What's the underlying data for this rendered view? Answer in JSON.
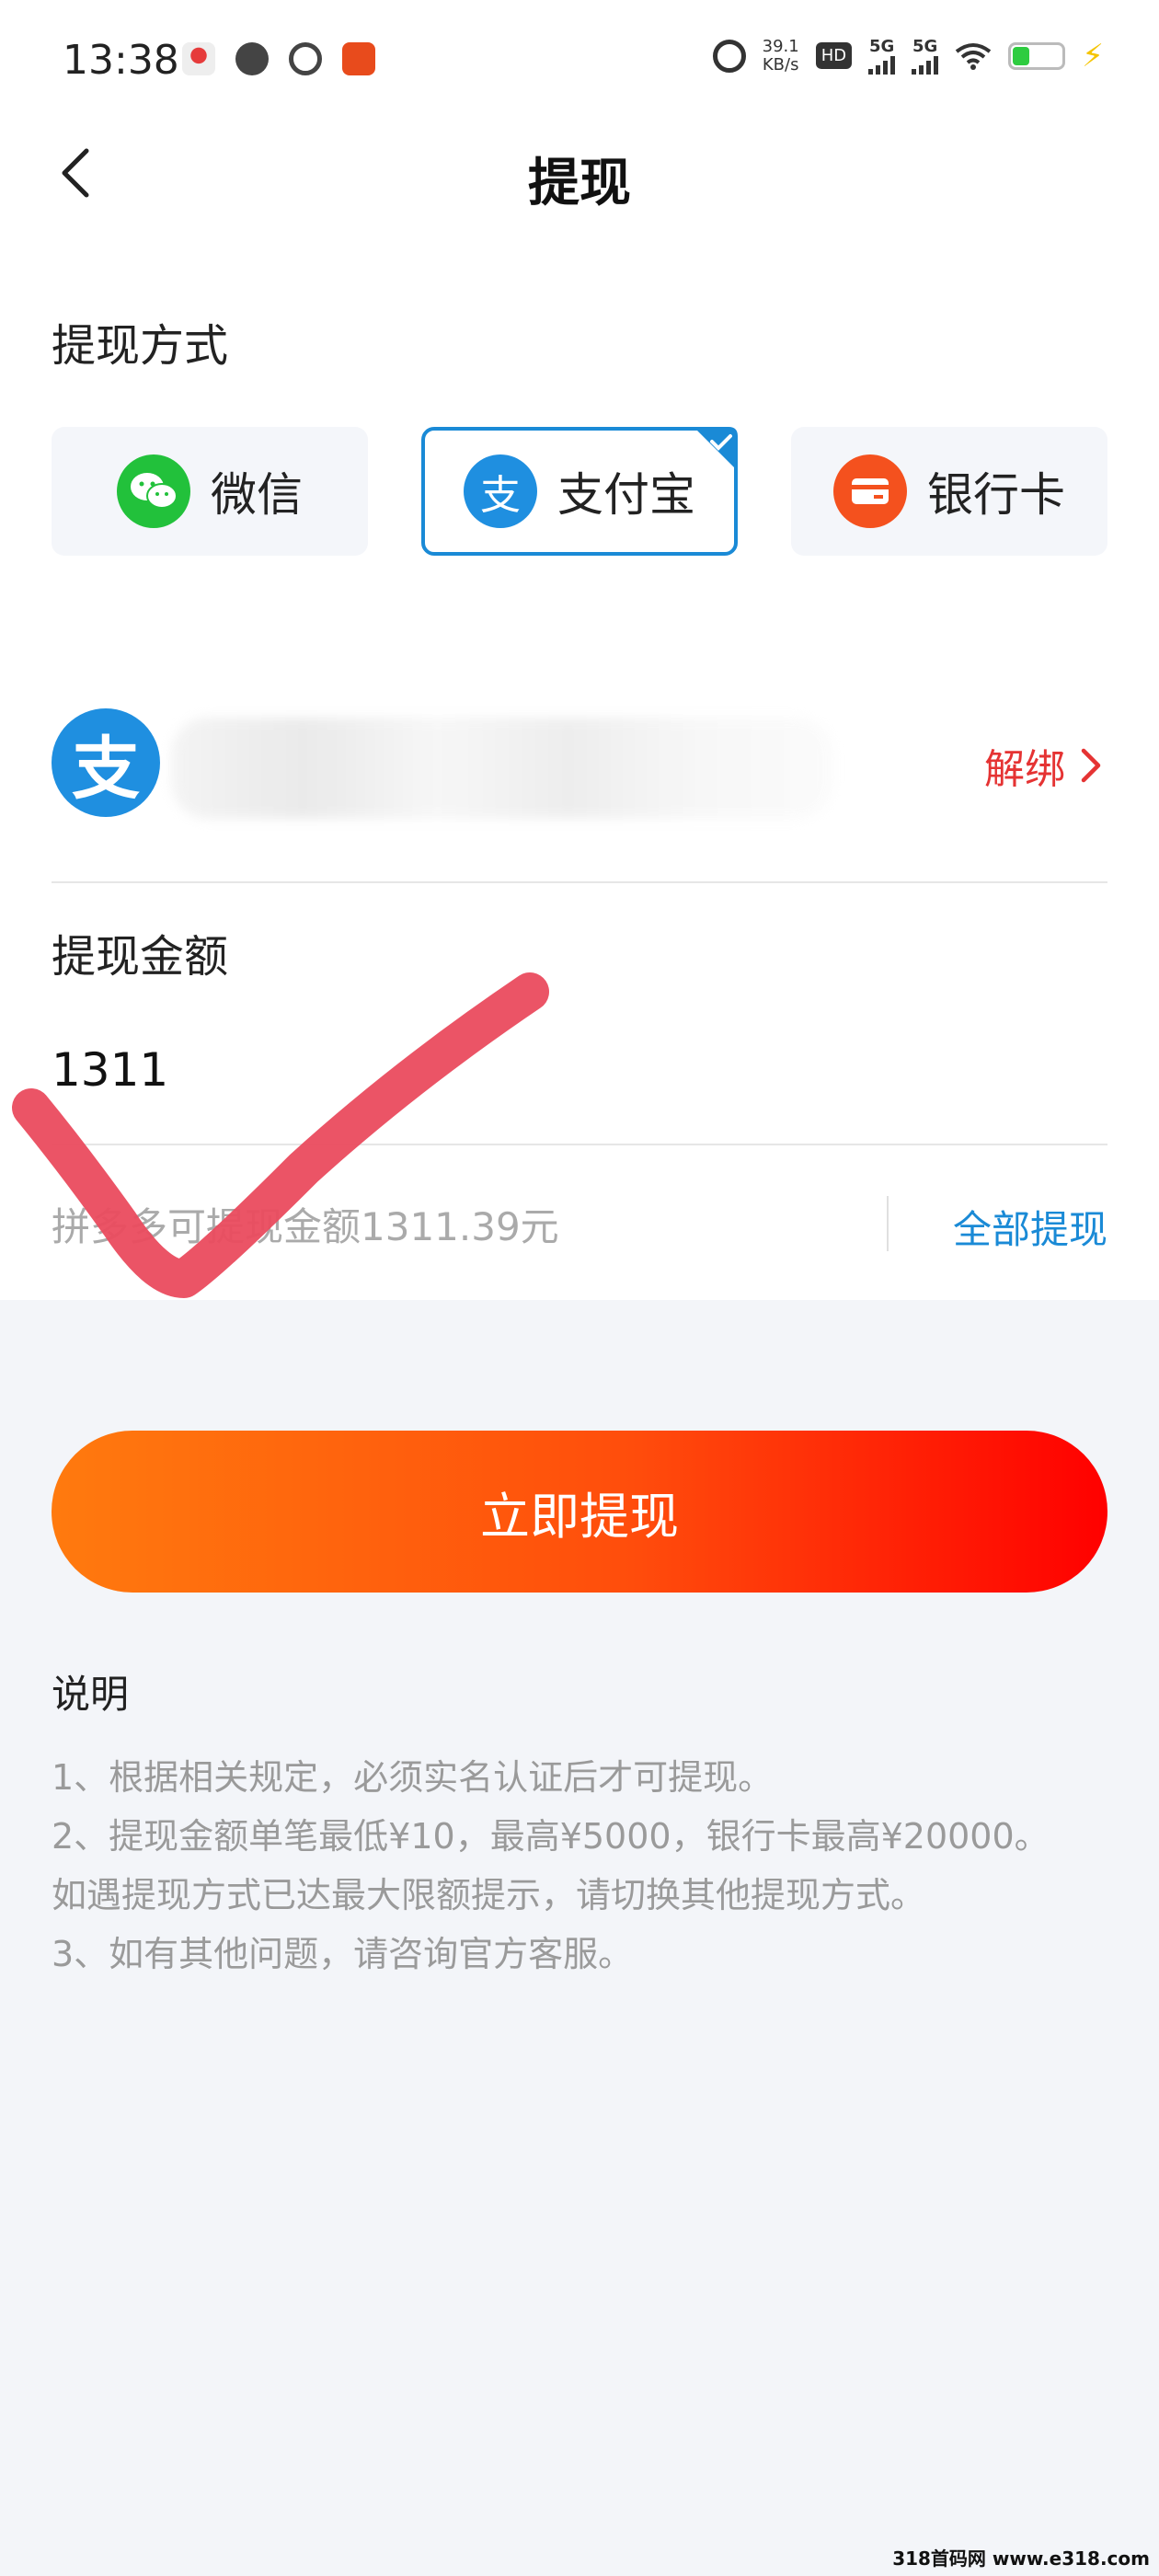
{
  "status_bar": {
    "time": "13:38",
    "net_speed_value": "39.1",
    "net_speed_unit": "KB/s",
    "hd_label": "HD",
    "sim1_label": "5G",
    "sim2_label": "5G"
  },
  "header": {
    "title": "提现"
  },
  "method": {
    "section_label": "提现方式",
    "options": [
      {
        "label": "微信",
        "icon": "wechat-icon",
        "selected": false
      },
      {
        "label": "支付宝",
        "icon": "alipay-icon",
        "selected": true
      },
      {
        "label": "银行卡",
        "icon": "bank-card-icon",
        "selected": false
      }
    ]
  },
  "account": {
    "avatar_glyph": "支",
    "unbind_label": "解绑"
  },
  "amount": {
    "section_label": "提现金额",
    "value": "1311",
    "available_text": "拼多多可提现金额1311.39元",
    "withdraw_all_label": "全部提现"
  },
  "submit": {
    "label": "立即提现"
  },
  "notes": {
    "title": "说明",
    "lines": [
      "1、根据相关规定，必须实名认证后才可提现。",
      "2、提现金额单笔最低¥10，最高¥5000，银行卡最高¥20000。",
      "如遇提现方式已达最大限额提示，请切换其他提现方式。",
      "3、如有其他问题，请咨询官方客服。"
    ]
  },
  "watermark": "318首码网 www.e318.com",
  "colors": {
    "accent_blue": "#1a8ad6",
    "unbind_red": "#e53333",
    "button_start": "#ff7a0e",
    "button_end": "#ff0000",
    "check_mark": "#ea4b5e"
  }
}
